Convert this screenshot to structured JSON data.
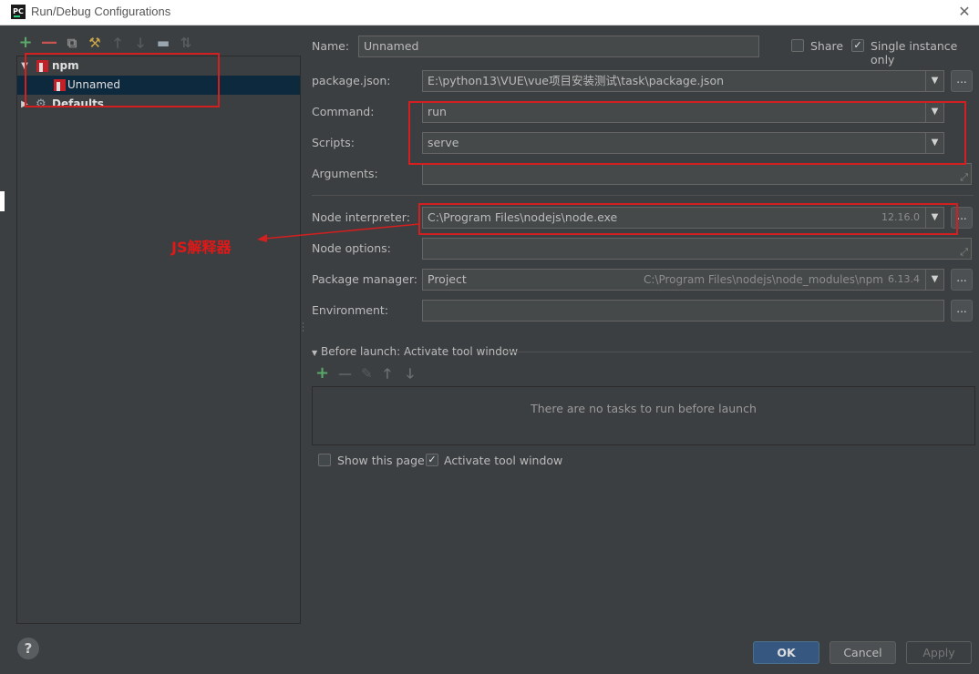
{
  "window": {
    "title": "Run/Debug Configurations",
    "app_icon": "PC",
    "close_glyph": "✕"
  },
  "left_toolbar": {
    "icons": [
      "add-icon",
      "remove-icon",
      "copy-icon",
      "wrench-icon",
      "move-up-icon",
      "move-down-icon",
      "folder-icon",
      "sort-icon"
    ],
    "add": "+",
    "remove": "—",
    "copy": "⧉",
    "wrench": "⚒",
    "up": "🡑",
    "down": "🡓",
    "folder": "▬",
    "sort": "⇅"
  },
  "tree": {
    "items": [
      {
        "label": "npm",
        "expanded": true
      },
      {
        "label": "Unnamed",
        "selected": true
      },
      {
        "label": "Defaults",
        "expanded": false
      }
    ],
    "expanded_glyph": "▼",
    "collapsed_glyph": "▶",
    "defaults_icon": "⚙"
  },
  "form": {
    "name_label": "Name:",
    "name_value": "Unnamed",
    "share_label": "Share",
    "share_checked": false,
    "single_instance_label": "Single instance only",
    "single_instance_checked": true,
    "package_json_label": "package.json:",
    "package_json_value": "E:\\python13\\VUE\\vue项目安装测试\\task\\package.json",
    "command_label": "Command:",
    "command_value": "run",
    "scripts_label": "Scripts:",
    "scripts_value": "serve",
    "arguments_label": "Arguments:",
    "arguments_value": "",
    "node_interpreter_label": "Node interpreter:",
    "node_interpreter_value": "C:\\Program Files\\nodejs\\node.exe",
    "node_version": "12.16.0",
    "node_options_label": "Node options:",
    "node_options_value": "",
    "package_manager_label": "Package manager:",
    "package_manager_value": "Project",
    "package_manager_path": "C:\\Program Files\\nodejs\\node_modules\\npm",
    "package_manager_version": "6.13.4",
    "environment_label": "Environment:",
    "environment_value": "",
    "ellipsis": "...",
    "dropdown_glyph": "▼",
    "expand_glyph": "⤢"
  },
  "before_launch": {
    "header": "Before launch: Activate tool window",
    "empty_text": "There are no tasks to run before launch",
    "add": "+",
    "remove": "—",
    "edit": "✎",
    "up": "🡑",
    "down": "🡓",
    "show_this_page_label": "Show this page",
    "show_this_page_checked": false,
    "activate_tool_window_label": "Activate tool window",
    "activate_tool_window_checked": true
  },
  "buttons": {
    "help": "?",
    "ok": "OK",
    "cancel": "Cancel",
    "apply": "Apply"
  },
  "annotation": {
    "text": "JS解释器",
    "color": "#d21f1f"
  },
  "check_glyph": "✓"
}
